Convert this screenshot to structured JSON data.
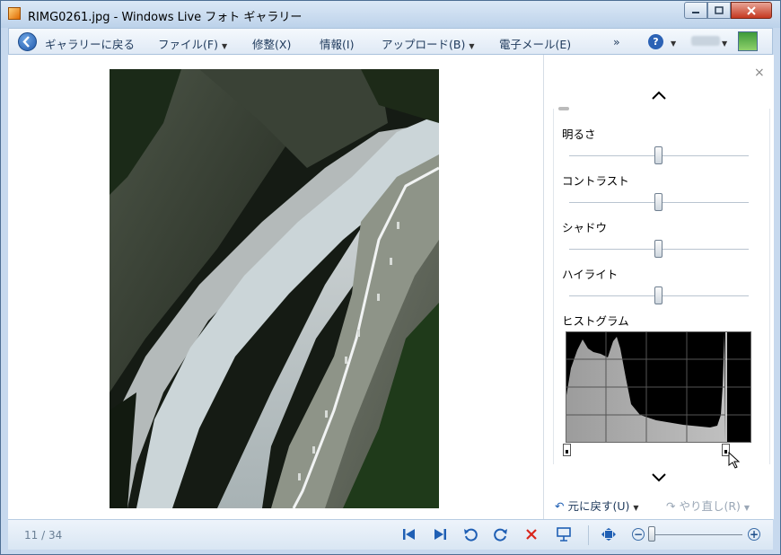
{
  "window": {
    "title": "RIMG0261.jpg - Windows Live フォト ギャラリー"
  },
  "menu": {
    "back": "ギャラリーに戻る",
    "file": "ファイル(F)",
    "fix": "修整(X)",
    "info": "情報(I)",
    "upload": "アップロード(B)",
    "email": "電子メール(E)",
    "overflow": "»",
    "help": "?"
  },
  "panel": {
    "close": "×",
    "sliders": [
      {
        "label": "明るさ",
        "level": 0.5
      },
      {
        "label": "コントラスト",
        "level": 0.5
      },
      {
        "label": "シャドウ",
        "level": 0.5
      },
      {
        "label": "ハイライト",
        "level": 0.5
      }
    ],
    "histogram_label": "ヒストグラム",
    "undo": "元に戻す(U)",
    "redo": "やり直し(R)"
  },
  "status": {
    "counter": "11 / 34",
    "zoom_level": 0.05
  },
  "colors": {
    "accent": "#1f5fb4",
    "delete": "#d9261c"
  }
}
